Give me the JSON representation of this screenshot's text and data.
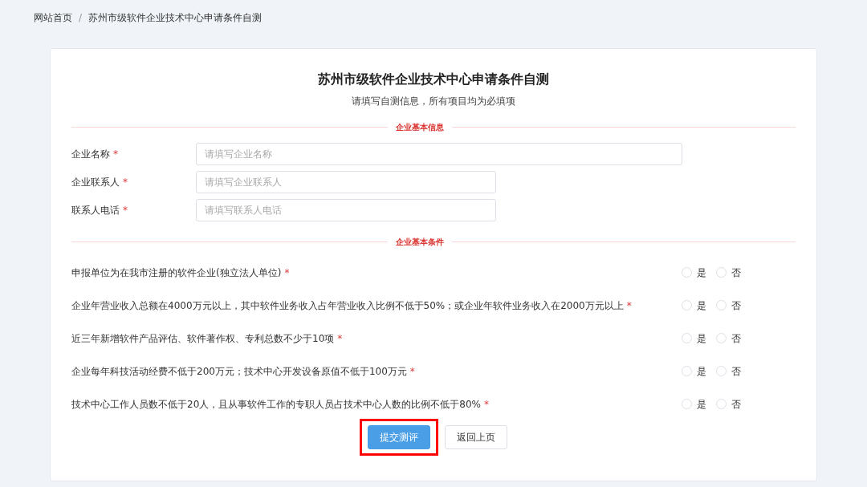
{
  "breadcrumb": [
    {
      "label": "网站首页"
    },
    {
      "label": "苏州市级软件企业技术中心申请条件自测"
    }
  ],
  "breadcrumb_separator": "/",
  "title": "苏州市级软件企业技术中心申请条件自测",
  "subtitle": "请填写自测信息，所有项目均为必填项",
  "sections": [
    {
      "heading": "企业基本信息",
      "fields": [
        {
          "label": "企业名称",
          "required_mark": "*",
          "placeholder": "请填写企业名称",
          "wide": true
        },
        {
          "label": "企业联系人",
          "required_mark": "*",
          "placeholder": "请填写企业联系人",
          "wide": false
        },
        {
          "label": "联系人电话",
          "required_mark": "*",
          "placeholder": "请填写联系人电话",
          "wide": false
        }
      ]
    },
    {
      "heading": "企业基本条件",
      "questions": [
        {
          "text": "申报单位为在我市注册的软件企业(独立法人单位)",
          "required_mark": "*",
          "options": [
            {
              "label": "是",
              "selected": false
            },
            {
              "label": "否",
              "selected": false
            }
          ]
        },
        {
          "text": "企业年营业收入总额在4000万元以上，其中软件业务收入占年营业收入比例不低于50%；或企业年软件业务收入在2000万元以上",
          "required_mark": "*",
          "options": [
            {
              "label": "是",
              "selected": false
            },
            {
              "label": "否",
              "selected": false
            }
          ]
        },
        {
          "text": "近三年新增软件产品评估、软件著作权、专利总数不少于10项",
          "required_mark": "*",
          "options": [
            {
              "label": "是",
              "selected": false
            },
            {
              "label": "否",
              "selected": false
            }
          ]
        },
        {
          "text": "企业每年科技活动经费不低于200万元；技术中心开发设备原值不低于100万元",
          "required_mark": "*",
          "options": [
            {
              "label": "是",
              "selected": false
            },
            {
              "label": "否",
              "selected": false
            }
          ]
        },
        {
          "text": "技术中心工作人员数不低于20人，且从事软件工作的专职人员占技术中心人数的比例不低于80%",
          "required_mark": "*",
          "options": [
            {
              "label": "是",
              "selected": false
            },
            {
              "label": "否",
              "selected": false
            }
          ]
        }
      ]
    }
  ],
  "buttons": [
    {
      "label": "提交测评",
      "kind": "primary",
      "highlighted": true
    },
    {
      "label": "返回上页",
      "kind": "default",
      "highlighted": false
    }
  ]
}
